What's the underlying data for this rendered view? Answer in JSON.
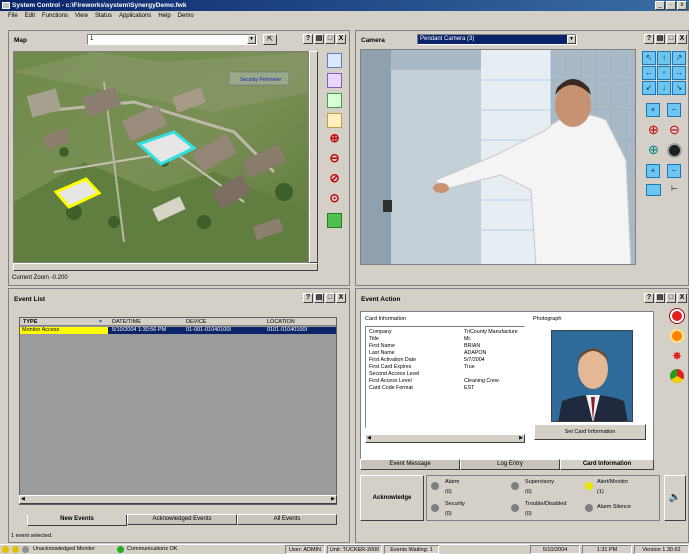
{
  "window": {
    "title": "System Control - c:\\Fireworks\\system\\SynergyDemo.fwk",
    "min": "_",
    "restore": "·",
    "close": "x"
  },
  "menu": [
    "File",
    "Edit",
    "Functions",
    "View",
    "Status",
    "Applications",
    "Help",
    "Demo"
  ],
  "map": {
    "title": "Map",
    "selected": "1",
    "label": "Security Perimeter",
    "zoom": "Current Zoom -0.200",
    "header_buttons": [
      "?",
      "▤",
      "□",
      "X"
    ]
  },
  "camera": {
    "title": "Camera",
    "selected": "Pendant Camera (3)",
    "header_buttons": [
      "?",
      "▤",
      "□",
      "X"
    ]
  },
  "event_list": {
    "title": "Event List",
    "columns": [
      "TYPE",
      "DATE/TIME",
      "DEVICE",
      "LOCATION"
    ],
    "rows": [
      [
        "Monitor Access",
        "5/10/2004 1:30:56 PM",
        "01-001-01040100I",
        "0101-01040100I"
      ]
    ],
    "tabs": [
      "New Events",
      "Acknowledged Events",
      "All Events"
    ],
    "status": "1 event selected.",
    "header_buttons": [
      "?",
      "▤",
      "□",
      "X"
    ]
  },
  "event_action": {
    "title": "Event Action",
    "card_info_label": "Card Information",
    "photo_label": "Photograph",
    "fields": [
      [
        "Company",
        "TriCounty Manufacture"
      ],
      [
        "Title",
        "Mr."
      ],
      [
        "First Name",
        "BRIAN"
      ],
      [
        "Last Name",
        "ADAPON"
      ],
      [
        "First Activation Date",
        "5/7/2004"
      ],
      [
        "First Card Expires",
        "True"
      ],
      [
        "Second Access Level",
        ""
      ],
      [
        "First Access Level",
        "Cleaning Crew"
      ],
      [
        "Card Code Format",
        "EST"
      ]
    ],
    "set_card_button": "Set Card Information",
    "tabs": [
      "Event Message",
      "Log Entry",
      "Card Information"
    ],
    "acknowledge": "Acknowledge",
    "alarm_groups": [
      {
        "label": "Alarm",
        "count": "(0)",
        "color": "#808080"
      },
      {
        "label": "Supervisory",
        "count": "(0)",
        "color": "#808080"
      },
      {
        "label": "Alert/Monitor",
        "count": "(1)",
        "color": "#e6e600"
      },
      {
        "label": "Security",
        "count": "(0)",
        "color": "#808080"
      },
      {
        "label": "Trouble/Disabled",
        "count": "(0)",
        "color": "#808080"
      },
      {
        "label": "Alarm Silence",
        "count": "",
        "color": "#808080"
      }
    ],
    "header_buttons": [
      "?",
      "▤",
      "□",
      "X"
    ]
  },
  "statusbar": {
    "unack": "Unacknowledged Monitor",
    "comms": "Communications OK",
    "user": "User: ADMIN",
    "unit": "Unit: TUCKER-2000",
    "events": "Events Waiting: 1",
    "date": "5/10/2004",
    "time": "1:31 PM",
    "version": "Version 1.30.62"
  },
  "colors": {
    "accent": "#0a246a",
    "selection": "#0a246a",
    "alert": "#ffff00",
    "nav": "#6cc6f0"
  }
}
